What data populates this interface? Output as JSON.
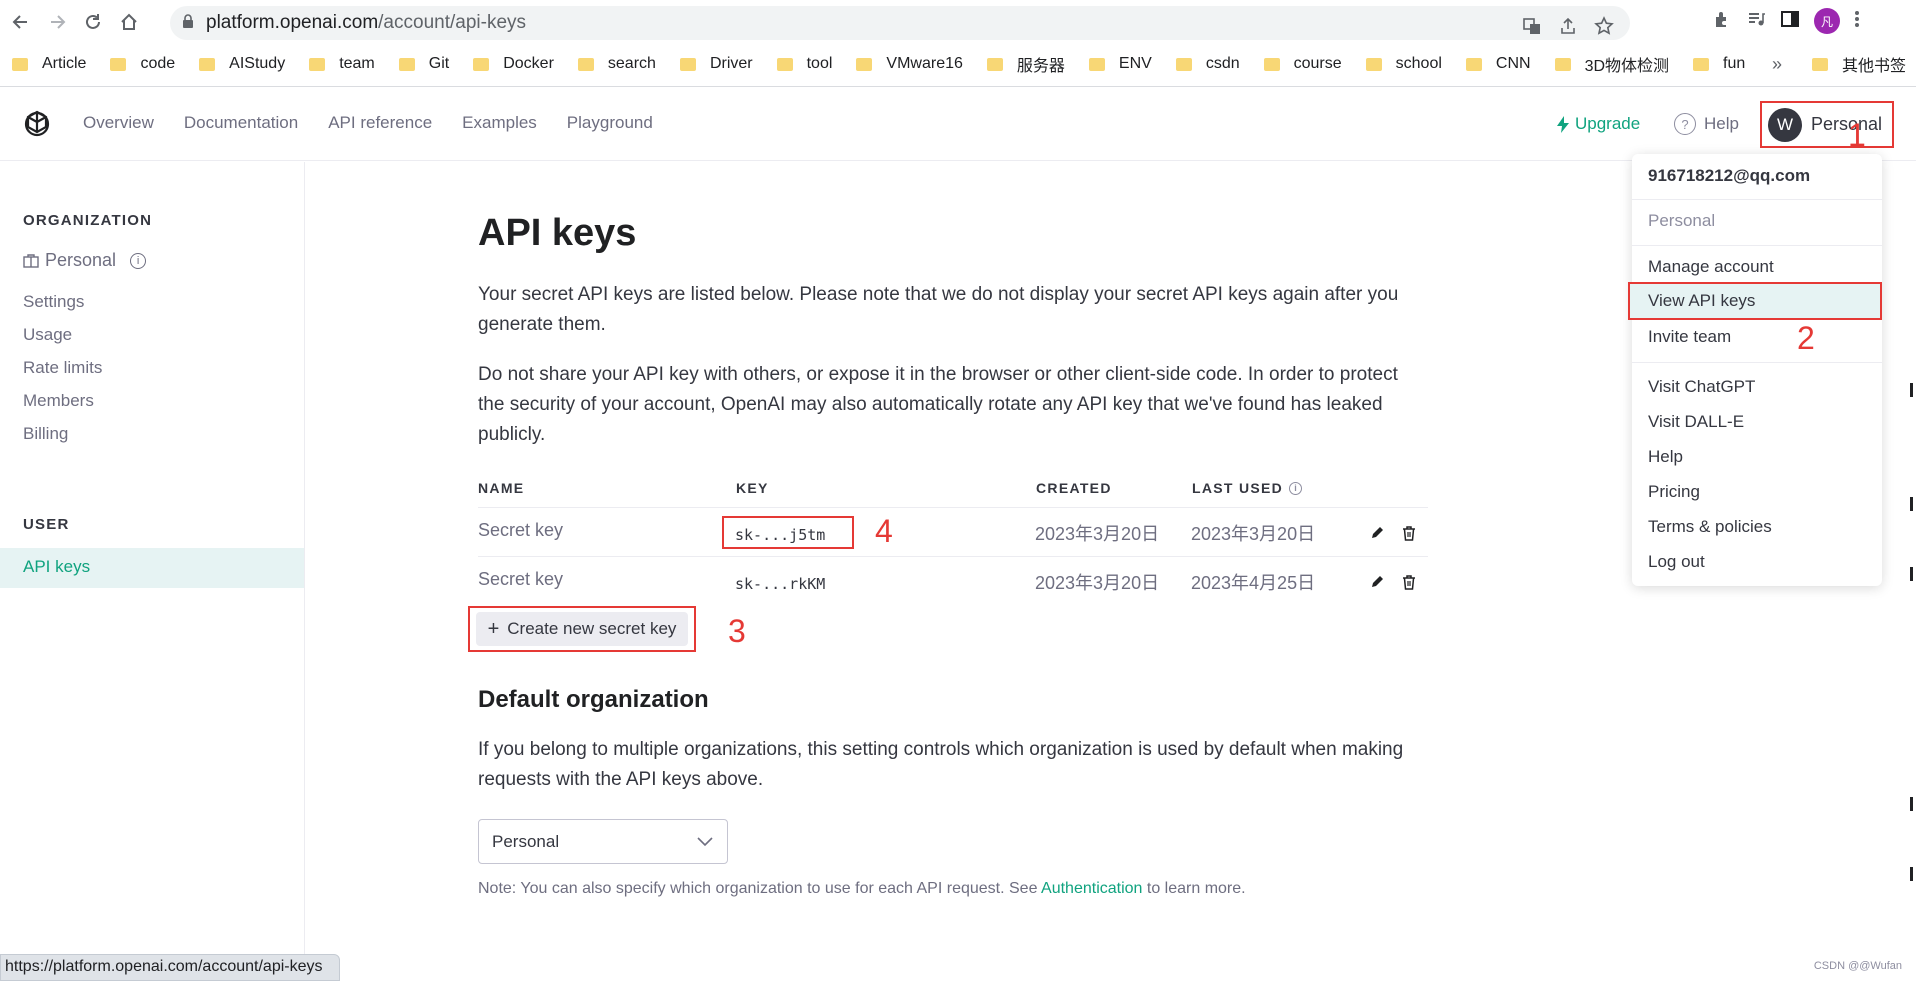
{
  "browser": {
    "url_host": "platform.openai.com",
    "url_path": "/account/api-keys",
    "profile_initial": "凡",
    "bookmarks": [
      "Article",
      "code",
      "AIStudy",
      "team",
      "Git",
      "Docker",
      "search",
      "Driver",
      "tool",
      "VMware16",
      "服务器",
      "ENV",
      "csdn",
      "course",
      "school",
      "CNN",
      "3D物体检测",
      "fun"
    ],
    "bookmarks_more": "»",
    "other_bookmarks": "其他书签",
    "status_url": "https://platform.openai.com/account/api-keys"
  },
  "topnav": {
    "links": [
      "Overview",
      "Documentation",
      "API reference",
      "Examples",
      "Playground"
    ],
    "upgrade": "Upgrade",
    "help": "Help",
    "avatar_letter": "W",
    "account_label": "Personal"
  },
  "sidebar": {
    "org_heading": "ORGANIZATION",
    "org_name": "Personal",
    "org_items": [
      "Settings",
      "Usage",
      "Rate limits",
      "Members",
      "Billing"
    ],
    "user_heading": "USER",
    "active_item": "API keys"
  },
  "main": {
    "title": "API keys",
    "para1": "Your secret API keys are listed below. Please note that we do not display your secret API keys again after you generate them.",
    "para2": "Do not share your API key with others, or expose it in the browser or other client-side code. In order to protect the security of your account, OpenAI may also automatically rotate any API key that we've found has leaked publicly.",
    "columns": [
      "NAME",
      "KEY",
      "CREATED",
      "LAST USED"
    ],
    "rows": [
      {
        "name": "Secret key",
        "key": "sk-...j5tm",
        "created": "2023年3月20日",
        "last_used": "2023年3月20日"
      },
      {
        "name": "Secret key",
        "key": "sk-...rkKM",
        "created": "2023年3月20日",
        "last_used": "2023年4月25日"
      }
    ],
    "create_button": "Create new secret key",
    "default_org_title": "Default organization",
    "default_org_text": "If you belong to multiple organizations, this setting controls which organization is used by default when making requests with the API keys above.",
    "org_select_value": "Personal",
    "note_prefix": "Note: You can also specify which organization to use for each API request. See ",
    "note_link": "Authentication",
    "note_suffix": " to learn more."
  },
  "dropdown": {
    "email": "916718212@qq.com",
    "org": "Personal",
    "items_group1": [
      "Manage account",
      "View API keys",
      "Invite team"
    ],
    "items_group2": [
      "Visit ChatGPT",
      "Visit DALL-E",
      "Help",
      "Pricing",
      "Terms & policies",
      "Log out"
    ]
  },
  "annotations": [
    "1",
    "2",
    "3",
    "4"
  ],
  "watermark": "CSDN @@Wufan",
  "colors": {
    "accent": "#10a37f",
    "annotation_red": "#e53935",
    "text": "#353740"
  }
}
